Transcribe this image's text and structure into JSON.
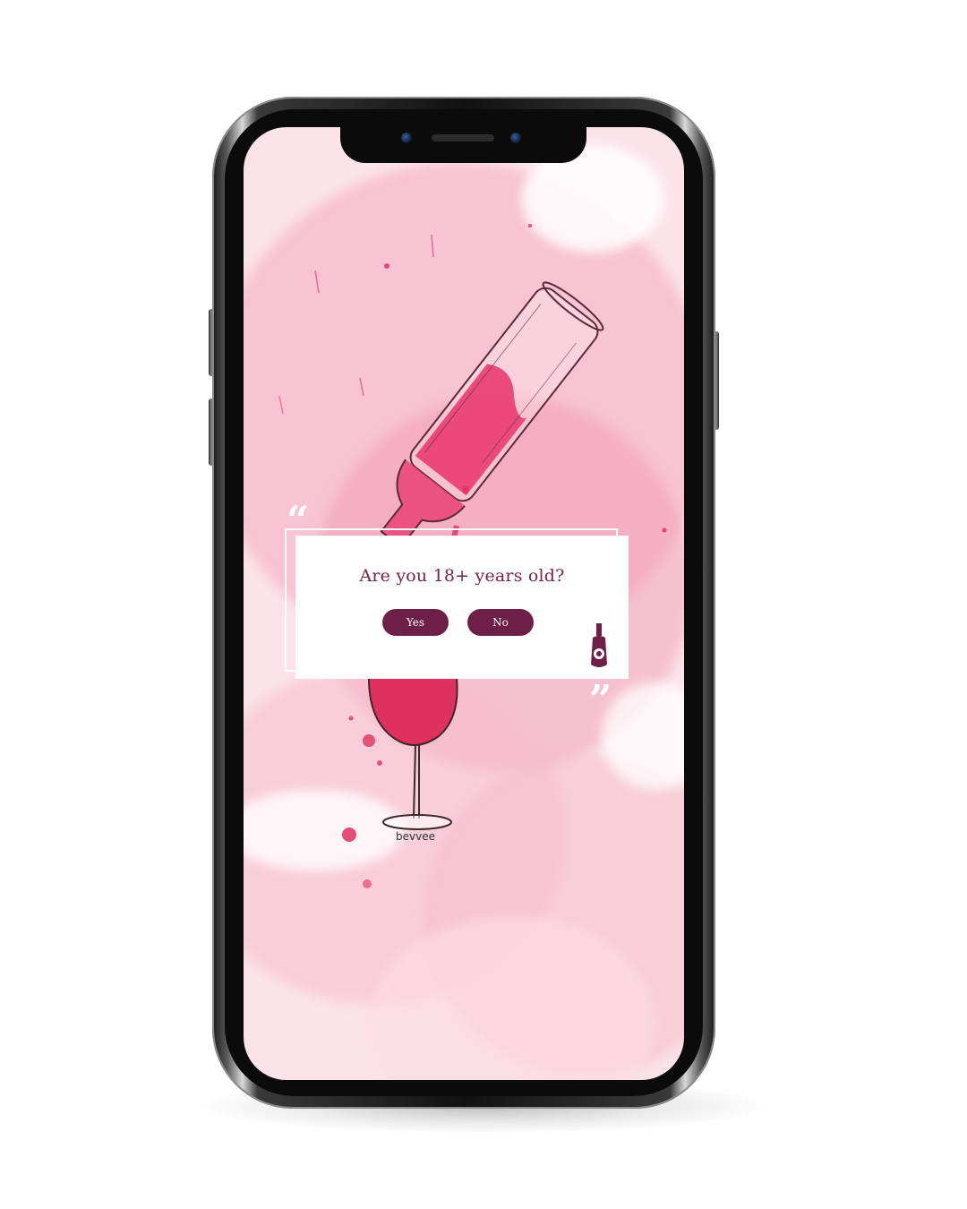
{
  "dialog": {
    "question": "Are you 18+ years old?",
    "yes_label": "Yes",
    "no_label": "No"
  },
  "brand": {
    "wordmark": "bevvee"
  },
  "colors": {
    "accent": "#6e1f48",
    "title": "#7a2148",
    "wine": "#e0305f"
  },
  "icons": {
    "open_quote": "open-quote-icon",
    "close_quote": "close-quote-icon",
    "bottle_logo": "wine-bottle-logo-icon"
  }
}
